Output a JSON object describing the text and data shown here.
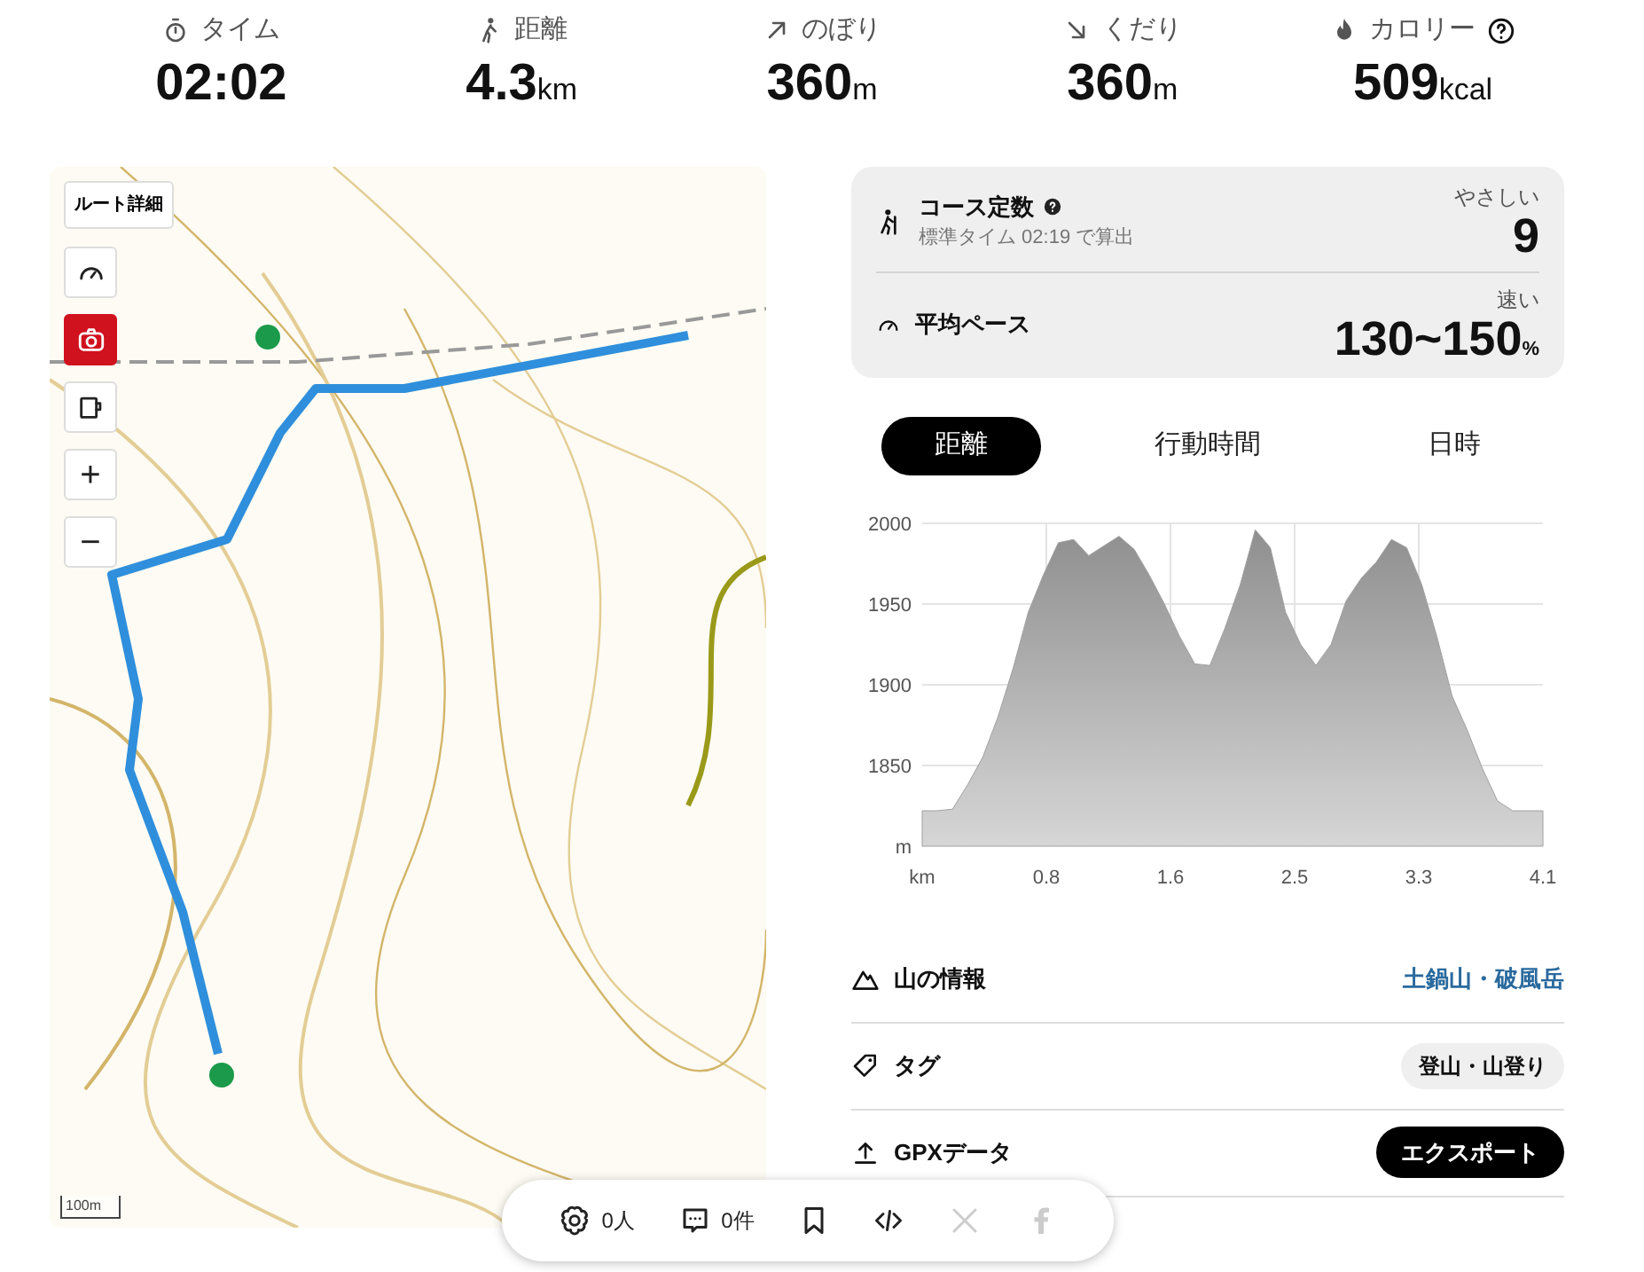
{
  "stats": [
    {
      "kind": "time",
      "label": "タイム",
      "value": "02:02"
    },
    {
      "kind": "distance",
      "label": "距離",
      "value": "4.3",
      "unit": "km"
    },
    {
      "kind": "up",
      "label": "のぼり",
      "value": "360",
      "unit": "m"
    },
    {
      "kind": "down",
      "label": "くだり",
      "value": "360",
      "unit": "m"
    },
    {
      "kind": "calorie",
      "label": "カロリー",
      "value": "509",
      "unit": "kcal",
      "help": true
    }
  ],
  "map": {
    "route_button": "ルート詳細",
    "tools": [
      {
        "kind": "speed",
        "on": false
      },
      {
        "kind": "camera",
        "on": true
      },
      {
        "kind": "cup",
        "on": false
      }
    ],
    "zoom": [
      "+",
      "−"
    ],
    "scale": "100m"
  },
  "course": {
    "title": "コース定数",
    "subtitle": "標準タイム 02:19 で算出",
    "rating": "やさしい",
    "value": "9"
  },
  "pace": {
    "title": "平均ペース",
    "rating": "速い",
    "value": "130~150",
    "unit": "%"
  },
  "tabs": [
    {
      "label": "距離",
      "selected": true
    },
    {
      "label": "行動時間",
      "selected": false
    },
    {
      "label": "日時",
      "selected": false
    }
  ],
  "chart_data": {
    "type": "area",
    "xlim": [
      0,
      4.1
    ],
    "ylim": [
      1800,
      2000
    ],
    "xticks": [
      {
        "value": 0,
        "label": "km"
      },
      {
        "value": 0.82,
        "label": "0.8"
      },
      {
        "value": 1.64,
        "label": "1.6"
      },
      {
        "value": 2.46,
        "label": "2.5"
      },
      {
        "value": 3.28,
        "label": "3.3"
      },
      {
        "value": 4.1,
        "label": "4.1"
      }
    ],
    "yticks": [
      {
        "value": 1800,
        "label": "m"
      },
      1850,
      1900,
      1950,
      2000
    ],
    "x": [
      0,
      0.1,
      0.2,
      0.3,
      0.4,
      0.5,
      0.6,
      0.7,
      0.8,
      0.9,
      1.0,
      1.1,
      1.2,
      1.3,
      1.4,
      1.5,
      1.6,
      1.7,
      1.8,
      1.9,
      2.0,
      2.1,
      2.2,
      2.3,
      2.4,
      2.5,
      2.6,
      2.7,
      2.8,
      2.9,
      3.0,
      3.1,
      3.2,
      3.3,
      3.4,
      3.5,
      3.6,
      3.7,
      3.8,
      3.9,
      4.0,
      4.1
    ],
    "grid": true,
    "series": [
      {
        "color": "#a0a0a0",
        "values": [
          1822,
          1822,
          1823,
          1838,
          1855,
          1880,
          1910,
          1945,
          1968,
          1988,
          1990,
          1980,
          1986,
          1992,
          1984,
          1968,
          1950,
          1930,
          1913,
          1912,
          1935,
          1962,
          1996,
          1985,
          1945,
          1925,
          1912,
          1925,
          1952,
          1966,
          1976,
          1990,
          1985,
          1962,
          1930,
          1893,
          1872,
          1848,
          1828,
          1822,
          1822,
          1822
        ]
      }
    ]
  },
  "info": [
    {
      "kind": "mountain",
      "label": "山の情報",
      "value": "土鍋山・破風岳"
    },
    {
      "kind": "tag",
      "label": "タグ",
      "value": "登山・山登り"
    },
    {
      "kind": "upload",
      "label": "GPXデータ",
      "value": "エクスポート"
    }
  ],
  "share_bar": [
    {
      "kind": "likes",
      "text": "0人",
      "disabled": false
    },
    {
      "kind": "comments",
      "text": "0件",
      "disabled": false
    },
    {
      "kind": "bookmark",
      "disabled": false
    },
    {
      "kind": "embed",
      "disabled": false
    },
    {
      "kind": "x",
      "disabled": true
    },
    {
      "kind": "facebook",
      "disabled": true
    }
  ]
}
